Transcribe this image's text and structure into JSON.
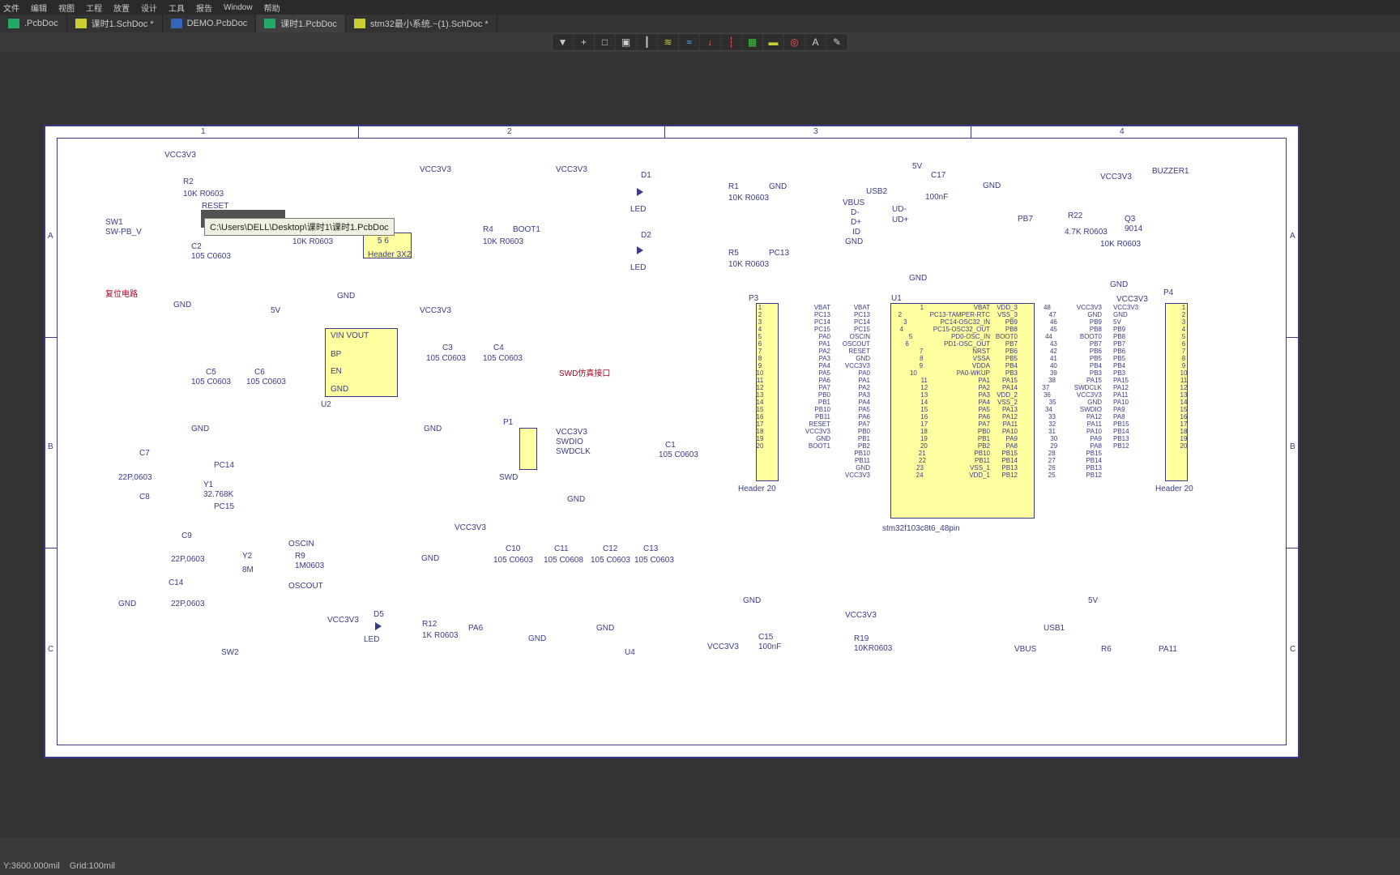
{
  "menubar": [
    "文件",
    "编辑",
    "视图",
    "工程",
    "放置",
    "设计",
    "工具",
    "报告",
    "Window",
    "帮助"
  ],
  "tabs": [
    {
      "label": ".PcbDoc",
      "icon": "ico-pcb",
      "active": false
    },
    {
      "label": "课时1.SchDoc *",
      "icon": "ico-sch",
      "active": false
    },
    {
      "label": "DEMO.PcbDoc",
      "icon": "ico-pcb2",
      "active": false
    },
    {
      "label": "课时1.PcbDoc",
      "icon": "ico-pcb",
      "active": true
    },
    {
      "label": "stm32最小系统.~(1).SchDoc *",
      "icon": "ico-sch",
      "active": false
    }
  ],
  "tooltip_path": "C:\\Users\\DELL\\Desktop\\课时1\\课时1.PcbDoc",
  "toolbar_icons": [
    "▼",
    "+",
    "□",
    "▣",
    "┃",
    "≋",
    "≈",
    "↓",
    "┆",
    "▦",
    "▬",
    "◎",
    "A",
    "✎"
  ],
  "status": {
    "coords": "Y:3600.000mil",
    "grid": "Grid:100mil"
  },
  "border": {
    "cols": [
      "1",
      "2",
      "3",
      "4"
    ],
    "rows": [
      "A",
      "B",
      "C"
    ]
  },
  "sch": {
    "reset": {
      "title": "复位电路",
      "vcc": "VCC3V3",
      "r2": "R2",
      "r2v": "10K R0603",
      "net": "RESET",
      "sw": "SW1",
      "swv": "SW-PB_V",
      "c2": "C2",
      "c2v": "105 C0603",
      "gnd": "GND"
    },
    "boot": {
      "vcc": "VCC3V3",
      "r3v": "10K R0603",
      "r4": "R4",
      "r4v": "10K R0603",
      "net": "BOOT1",
      "hdr": "Header 3X2",
      "p56": "5    6",
      "gnd": "GND"
    },
    "reg": {
      "v5": "5V",
      "c5": "C5",
      "c6": "C6",
      "cv": "105 C0603",
      "gnd": "GND",
      "vin": "VIN VOUT",
      "bp": "BP",
      "en": "EN",
      "gnd2": "GND",
      "u2": "U2",
      "vout_c": "C3",
      "vout_c2": "C4",
      "vout_cv": "105 C0603",
      "vout": "VCC3V3"
    },
    "led": {
      "vcc": "VCC3V3",
      "d1": "D1",
      "d2": "D2",
      "led": "LED",
      "r1": "R1",
      "r5": "R5",
      "rv": "10K R0603",
      "net1": "GND",
      "net2": "PC13"
    },
    "swd": {
      "title": "SWD仿真接口",
      "p1": "P1",
      "vcc": "VCC3V3",
      "a": "SWDIO",
      "b": "SWDCLK",
      "c1": "C1",
      "c1v": "105 C0603",
      "gnd": "GND",
      "conn": "SWD"
    },
    "usb": {
      "v5": "5V",
      "c17": "C17",
      "c17v": "100nF",
      "gnd": "GND",
      "u": "USB2",
      "lbls": [
        "VBUS",
        "D-",
        "D+",
        "ID",
        "GND"
      ],
      "udm": "UD-",
      "udp": "UD+"
    },
    "buz": {
      "vcc": "VCC3V3",
      "bz": "BUZZER1",
      "r22": "R22",
      "r22v": "4.7K R0603",
      "q3": "Q3",
      "q3v": "9014",
      "pb7": "PB7",
      "r": "10K R0603",
      "gnd": "GND"
    },
    "xtal1": {
      "c7": "C7",
      "c8": "C8",
      "cv": "22P,0603",
      "y1": "Y1",
      "y1v": "32.768K",
      "n1": "PC14",
      "n2": "PC15"
    },
    "xtal2": {
      "c9": "C9",
      "c14": "C14",
      "cv": "22P,0603",
      "y2": "Y2",
      "y2v": "8M",
      "r9": "R9",
      "r9v": "1M0603",
      "n1": "OSCIN",
      "n2": "OSCOUT",
      "gnd": "GND"
    },
    "caps": {
      "vcc": "VCC3V3",
      "gnd": "GND",
      "c": [
        "C10",
        "C11",
        "C12",
        "C13"
      ],
      "cv": [
        "105 C0603",
        "105 C0608",
        "105 C0603",
        "105 C0603"
      ]
    },
    "key": {
      "vcc": "VCC3V3",
      "d5": "D5",
      "d5v": "LED",
      "r12": "R12",
      "r12v": "1K R0603",
      "net": "PA6",
      "sw2": "SW2",
      "gnd": "GND",
      "u4": "U4"
    },
    "vcap": {
      "gnd": "GND",
      "c15": "C15",
      "c15v": "100nF",
      "vcc": "VCC3V3"
    },
    "r19": {
      "vcc": "VCC3V3",
      "r19": "R19",
      "r19v": "10KR0603"
    },
    "usb1": {
      "v5": "5V",
      "u": "USB1",
      "vbus": "VBUS",
      "r6": "R6",
      "pa11": "PA11"
    },
    "p3": {
      "title": "P3",
      "footer": "Header 20",
      "rows": [
        [
          "1",
          "VBAT"
        ],
        [
          "2",
          "PC13"
        ],
        [
          "3",
          "PC14"
        ],
        [
          "4",
          "PC15"
        ],
        [
          "5",
          "PA0"
        ],
        [
          "6",
          "PA1"
        ],
        [
          "7",
          "PA2"
        ],
        [
          "8",
          "PA3"
        ],
        [
          "9",
          "PA4"
        ],
        [
          "10",
          "PA5"
        ],
        [
          "11",
          "PA6"
        ],
        [
          "12",
          "PA7"
        ],
        [
          "13",
          "PB0"
        ],
        [
          "14",
          "PB1"
        ],
        [
          "15",
          "PB10"
        ],
        [
          "16",
          "PB11"
        ],
        [
          "17",
          "RESET"
        ],
        [
          "18",
          "VCC3V3"
        ],
        [
          "19",
          "GND"
        ],
        [
          "20",
          "BOOT1"
        ]
      ]
    },
    "p4": {
      "title": "P4",
      "footer": "Header 20",
      "rows": [
        [
          "VCC3V3",
          "1"
        ],
        [
          "GND",
          "2"
        ],
        [
          "5V",
          "3"
        ],
        [
          "PB9",
          "4"
        ],
        [
          "PB8",
          "5"
        ],
        [
          "PB7",
          "6"
        ],
        [
          "PB6",
          "7"
        ],
        [
          "PB5",
          "8"
        ],
        [
          "PB4",
          "9"
        ],
        [
          "PB3",
          "10"
        ],
        [
          "PA15",
          "11"
        ],
        [
          "PA12",
          "12"
        ],
        [
          "PA11",
          "13"
        ],
        [
          "PA10",
          "14"
        ],
        [
          "PA9",
          "15"
        ],
        [
          "PA8",
          "16"
        ],
        [
          "PB15",
          "17"
        ],
        [
          "PB14",
          "18"
        ],
        [
          "PB13",
          "19"
        ],
        [
          "PB12",
          "20"
        ]
      ]
    },
    "u1": {
      "title": "U1",
      "footer": "stm32f103c8t6_48pin",
      "left": [
        [
          "VBAT",
          "1",
          "VBAT"
        ],
        [
          "PC13",
          "2",
          "PC13-TAMPER-RTC"
        ],
        [
          "PC14",
          "3",
          "PC14-OSC32_IN"
        ],
        [
          "PC15",
          "4",
          "PC15-OSC32_OUT"
        ],
        [
          "OSCIN",
          "5",
          "PD0-OSC_IN"
        ],
        [
          "OSCOUT",
          "6",
          "PD1-OSC_OUT"
        ],
        [
          "RESET",
          "7",
          "NRST"
        ],
        [
          "GND",
          "8",
          "VSSA"
        ],
        [
          "VCC3V3",
          "9",
          "VDDA"
        ],
        [
          "PA0",
          "10",
          "PA0-WKUP"
        ],
        [
          "PA1",
          "11",
          "PA1"
        ],
        [
          "PA2",
          "12",
          "PA2"
        ],
        [
          "PA3",
          "13",
          "PA3"
        ],
        [
          "PA4",
          "14",
          "PA4"
        ],
        [
          "PA5",
          "15",
          "PA5"
        ],
        [
          "PA6",
          "16",
          "PA6"
        ],
        [
          "PA7",
          "17",
          "PA7"
        ],
        [
          "PB0",
          "18",
          "PB0"
        ],
        [
          "PB1",
          "19",
          "PB1"
        ],
        [
          "PB2",
          "20",
          "PB2"
        ],
        [
          "PB10",
          "21",
          "PB10"
        ],
        [
          "PB11",
          "22",
          "PB11"
        ],
        [
          "GND",
          "23",
          "VSS_1"
        ],
        [
          "VCC3V3",
          "24",
          "VDD_1"
        ]
      ],
      "right": [
        [
          "VDD_3",
          "48",
          "VCC3V3"
        ],
        [
          "VSS_3",
          "47",
          "GND"
        ],
        [
          "PB9",
          "46",
          "PB9"
        ],
        [
          "PB8",
          "45",
          "PB8"
        ],
        [
          "BOOT0",
          "44",
          "BOOT0"
        ],
        [
          "PB7",
          "43",
          "PB7"
        ],
        [
          "PB6",
          "42",
          "PB6"
        ],
        [
          "PB5",
          "41",
          "PB5"
        ],
        [
          "PB4",
          "40",
          "PB4"
        ],
        [
          "PB3",
          "39",
          "PB3"
        ],
        [
          "PA15",
          "38",
          "PA15"
        ],
        [
          "PA14",
          "37",
          "SWDCLK"
        ],
        [
          "VDD_2",
          "36",
          "VCC3V3"
        ],
        [
          "VSS_2",
          "35",
          "GND"
        ],
        [
          "PA13",
          "34",
          "SWDIO"
        ],
        [
          "PA12",
          "33",
          "PA12"
        ],
        [
          "PA11",
          "32",
          "PA11"
        ],
        [
          "PA10",
          "31",
          "PA10"
        ],
        [
          "PA9",
          "30",
          "PA9"
        ],
        [
          "PA8",
          "29",
          "PA8"
        ],
        [
          "PB15",
          "28",
          "PB15"
        ],
        [
          "PB14",
          "27",
          "PB14"
        ],
        [
          "PB13",
          "26",
          "PB13"
        ],
        [
          "PB12",
          "25",
          "PB12"
        ]
      ]
    }
  }
}
